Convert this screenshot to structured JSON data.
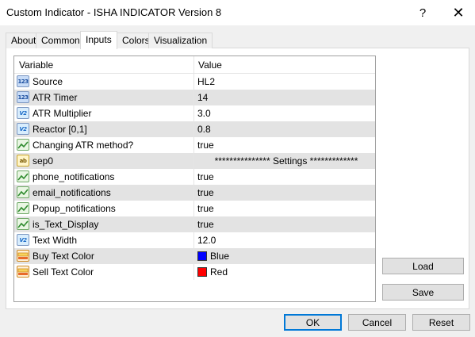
{
  "window": {
    "title": "Custom Indicator - ISHA INDICATOR Version 8",
    "help_label": "?",
    "close_label": "✕"
  },
  "tabs": [
    {
      "label": "About"
    },
    {
      "label": "Common"
    },
    {
      "label": "Inputs"
    },
    {
      "label": "Colors"
    },
    {
      "label": "Visualization"
    }
  ],
  "active_tab": "Inputs",
  "table": {
    "headers": {
      "variable": "Variable",
      "value": "Value"
    },
    "rows": [
      {
        "icon": "int-type-icon",
        "icon_text": "123",
        "name": "Source",
        "value": "HL2"
      },
      {
        "icon": "int-type-icon",
        "icon_text": "123",
        "name": "ATR Timer",
        "value": "14"
      },
      {
        "icon": "double-type-icon",
        "icon_text": "V2",
        "name": "ATR Multiplier",
        "value": "3.0"
      },
      {
        "icon": "double-type-icon",
        "icon_text": "V2",
        "name": "Reactor [0,1]",
        "value": "0.8"
      },
      {
        "icon": "bool-type-icon",
        "icon_text": "",
        "name": "Changing ATR method?",
        "value": "true"
      },
      {
        "icon": "string-type-icon",
        "icon_text": "ab",
        "name": "sep0",
        "value": "*************** Settings *************"
      },
      {
        "icon": "bool-type-icon",
        "icon_text": "",
        "name": "phone_notifications",
        "value": "true"
      },
      {
        "icon": "bool-type-icon",
        "icon_text": "",
        "name": "email_notifications",
        "value": "true"
      },
      {
        "icon": "bool-type-icon",
        "icon_text": "",
        "name": "Popup_notifications",
        "value": "true"
      },
      {
        "icon": "bool-type-icon",
        "icon_text": "",
        "name": "is_Text_Display",
        "value": "true"
      },
      {
        "icon": "double-type-icon",
        "icon_text": "V2",
        "name": "Text Width",
        "value": "12.0"
      },
      {
        "icon": "color-type-icon",
        "icon_text": "",
        "name": "Buy Text Color",
        "value": "Blue",
        "swatch": "#0000ff"
      },
      {
        "icon": "color-type-icon",
        "icon_text": "",
        "name": "Sell Text Color",
        "value": "Red",
        "swatch": "#ff0000"
      }
    ]
  },
  "buttons": {
    "load": "Load",
    "save": "Save",
    "ok": "OK",
    "cancel": "Cancel",
    "reset": "Reset"
  },
  "colors": {
    "row_alt": "#e3e3e3",
    "focus_border": "#0078d7",
    "button_face": "#e1e1e1"
  }
}
